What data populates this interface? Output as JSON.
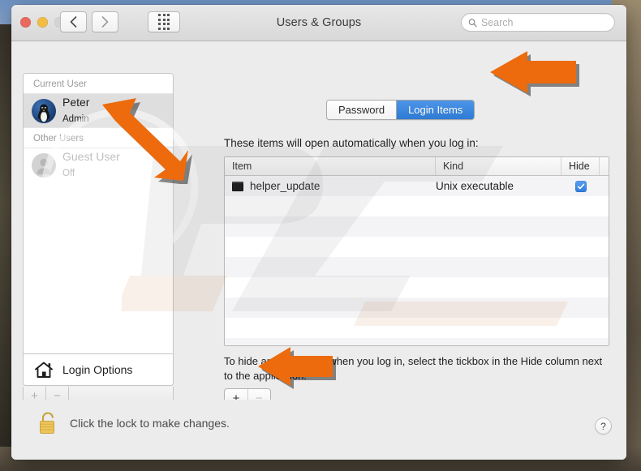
{
  "window": {
    "title": "Users & Groups",
    "traffic_lights": [
      "close-button",
      "minimize-button",
      "zoom-button"
    ],
    "back_label": "‹",
    "forward_label": "›",
    "show_all_label": "Show All"
  },
  "search": {
    "placeholder": "Search",
    "value": ""
  },
  "sidebar": {
    "current_user_header": "Current User",
    "other_users_header": "Other Users",
    "users": [
      {
        "name": "Peter",
        "role": "Admin",
        "selected": true,
        "avatar": "penguin-avatar"
      },
      {
        "name": "Guest User",
        "role": "Off",
        "selected": false,
        "avatar": "guest-avatar"
      }
    ],
    "login_options_label": "Login Options",
    "add_label": "+",
    "remove_label": "−"
  },
  "pane": {
    "tabs": [
      {
        "label": "Password",
        "active": false
      },
      {
        "label": "Login Items",
        "active": true
      }
    ],
    "description": "These items will open automatically when you log in:",
    "table": {
      "columns": [
        "Item",
        "Kind",
        "Hide"
      ],
      "rows": [
        {
          "item": "helper_update",
          "kind": "Unix executable",
          "hide": true
        }
      ],
      "empty_rows": 8
    },
    "hint": "To hide an application when you log in, select the tickbox in the Hide column next to the application.",
    "add_label": "+",
    "remove_label": "−"
  },
  "footer": {
    "lock_text": "Click the lock to make changes.",
    "lock_state": "locked",
    "help_label": "?"
  },
  "annotations": {
    "arrow_color": "#ED6B0C",
    "arrows": [
      {
        "name": "arrow-pointing-login-items-tab",
        "direction": "left"
      },
      {
        "name": "arrow-pointing-current-user",
        "direction": "up-left"
      },
      {
        "name": "arrow-pointing-add-remove-buttons",
        "direction": "left"
      }
    ]
  },
  "colors": {
    "accent_blue": "#2f7bd4",
    "checkbox_blue": "#3d86e4",
    "arrow_orange": "#ED6B0C",
    "lock_gold": "#E8B84B",
    "window_bg": "#ececec"
  }
}
